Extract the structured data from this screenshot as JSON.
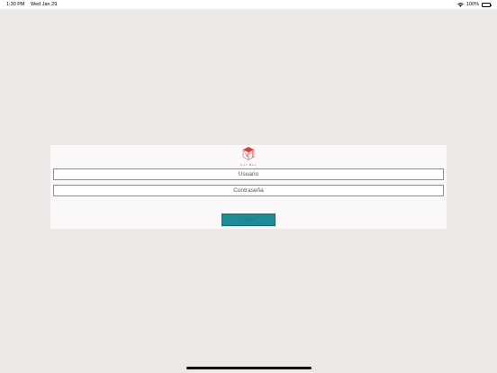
{
  "status_bar": {
    "time": "1:30 PM",
    "date": "Wed Jan 29",
    "battery_percent": "100%",
    "icons": [
      "wifi-icon",
      "battery-icon"
    ]
  },
  "logo": {
    "icon": "cube-logo-icon",
    "text": "Virt Box",
    "accent_color": "#d83a3a"
  },
  "form": {
    "username_placeholder": "Usuario",
    "password_placeholder": "Contraseña",
    "submit_label": "Login",
    "button_color": "#1e8b96"
  }
}
